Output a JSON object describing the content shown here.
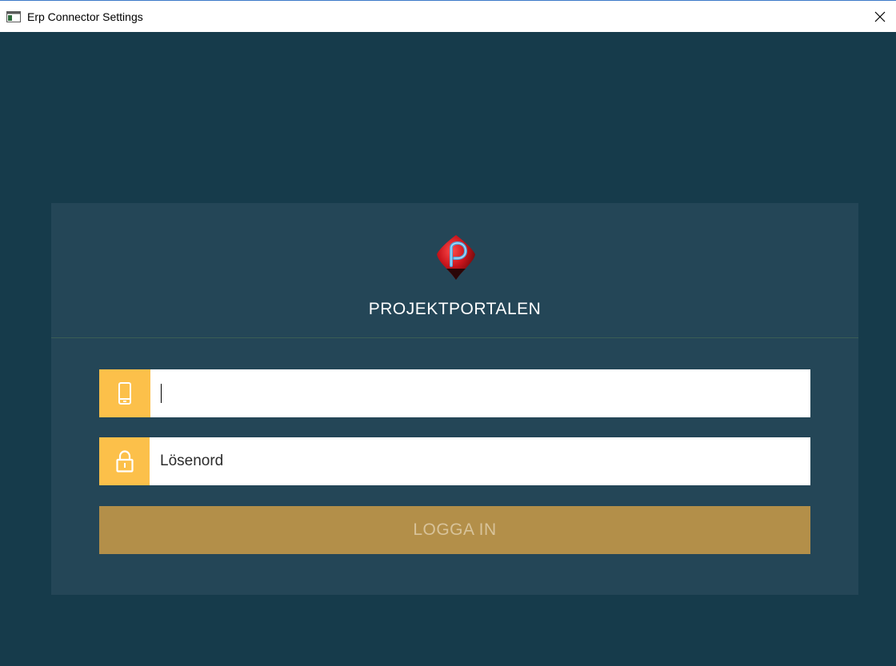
{
  "window": {
    "title": "Erp Connector Settings",
    "close_glyph": "✕"
  },
  "login": {
    "brand": "PROJEKTPORTALEN",
    "phone": {
      "value": "",
      "placeholder": ""
    },
    "password": {
      "value": "",
      "placeholder": "Lösenord"
    },
    "submit_label": "LOGGA IN"
  },
  "icons": {
    "app": "window-icon",
    "close": "close-icon",
    "logo": "projektportalen-logo",
    "phone": "mobile-phone-icon",
    "password": "padlock-icon"
  },
  "colors": {
    "background": "#163b4b",
    "card": "#244657",
    "accent": "#fcc04a",
    "button": "#b38f49",
    "button_text": "#d8c39a",
    "logo_red": "#c8141b",
    "logo_blue": "#4fa8e0"
  }
}
